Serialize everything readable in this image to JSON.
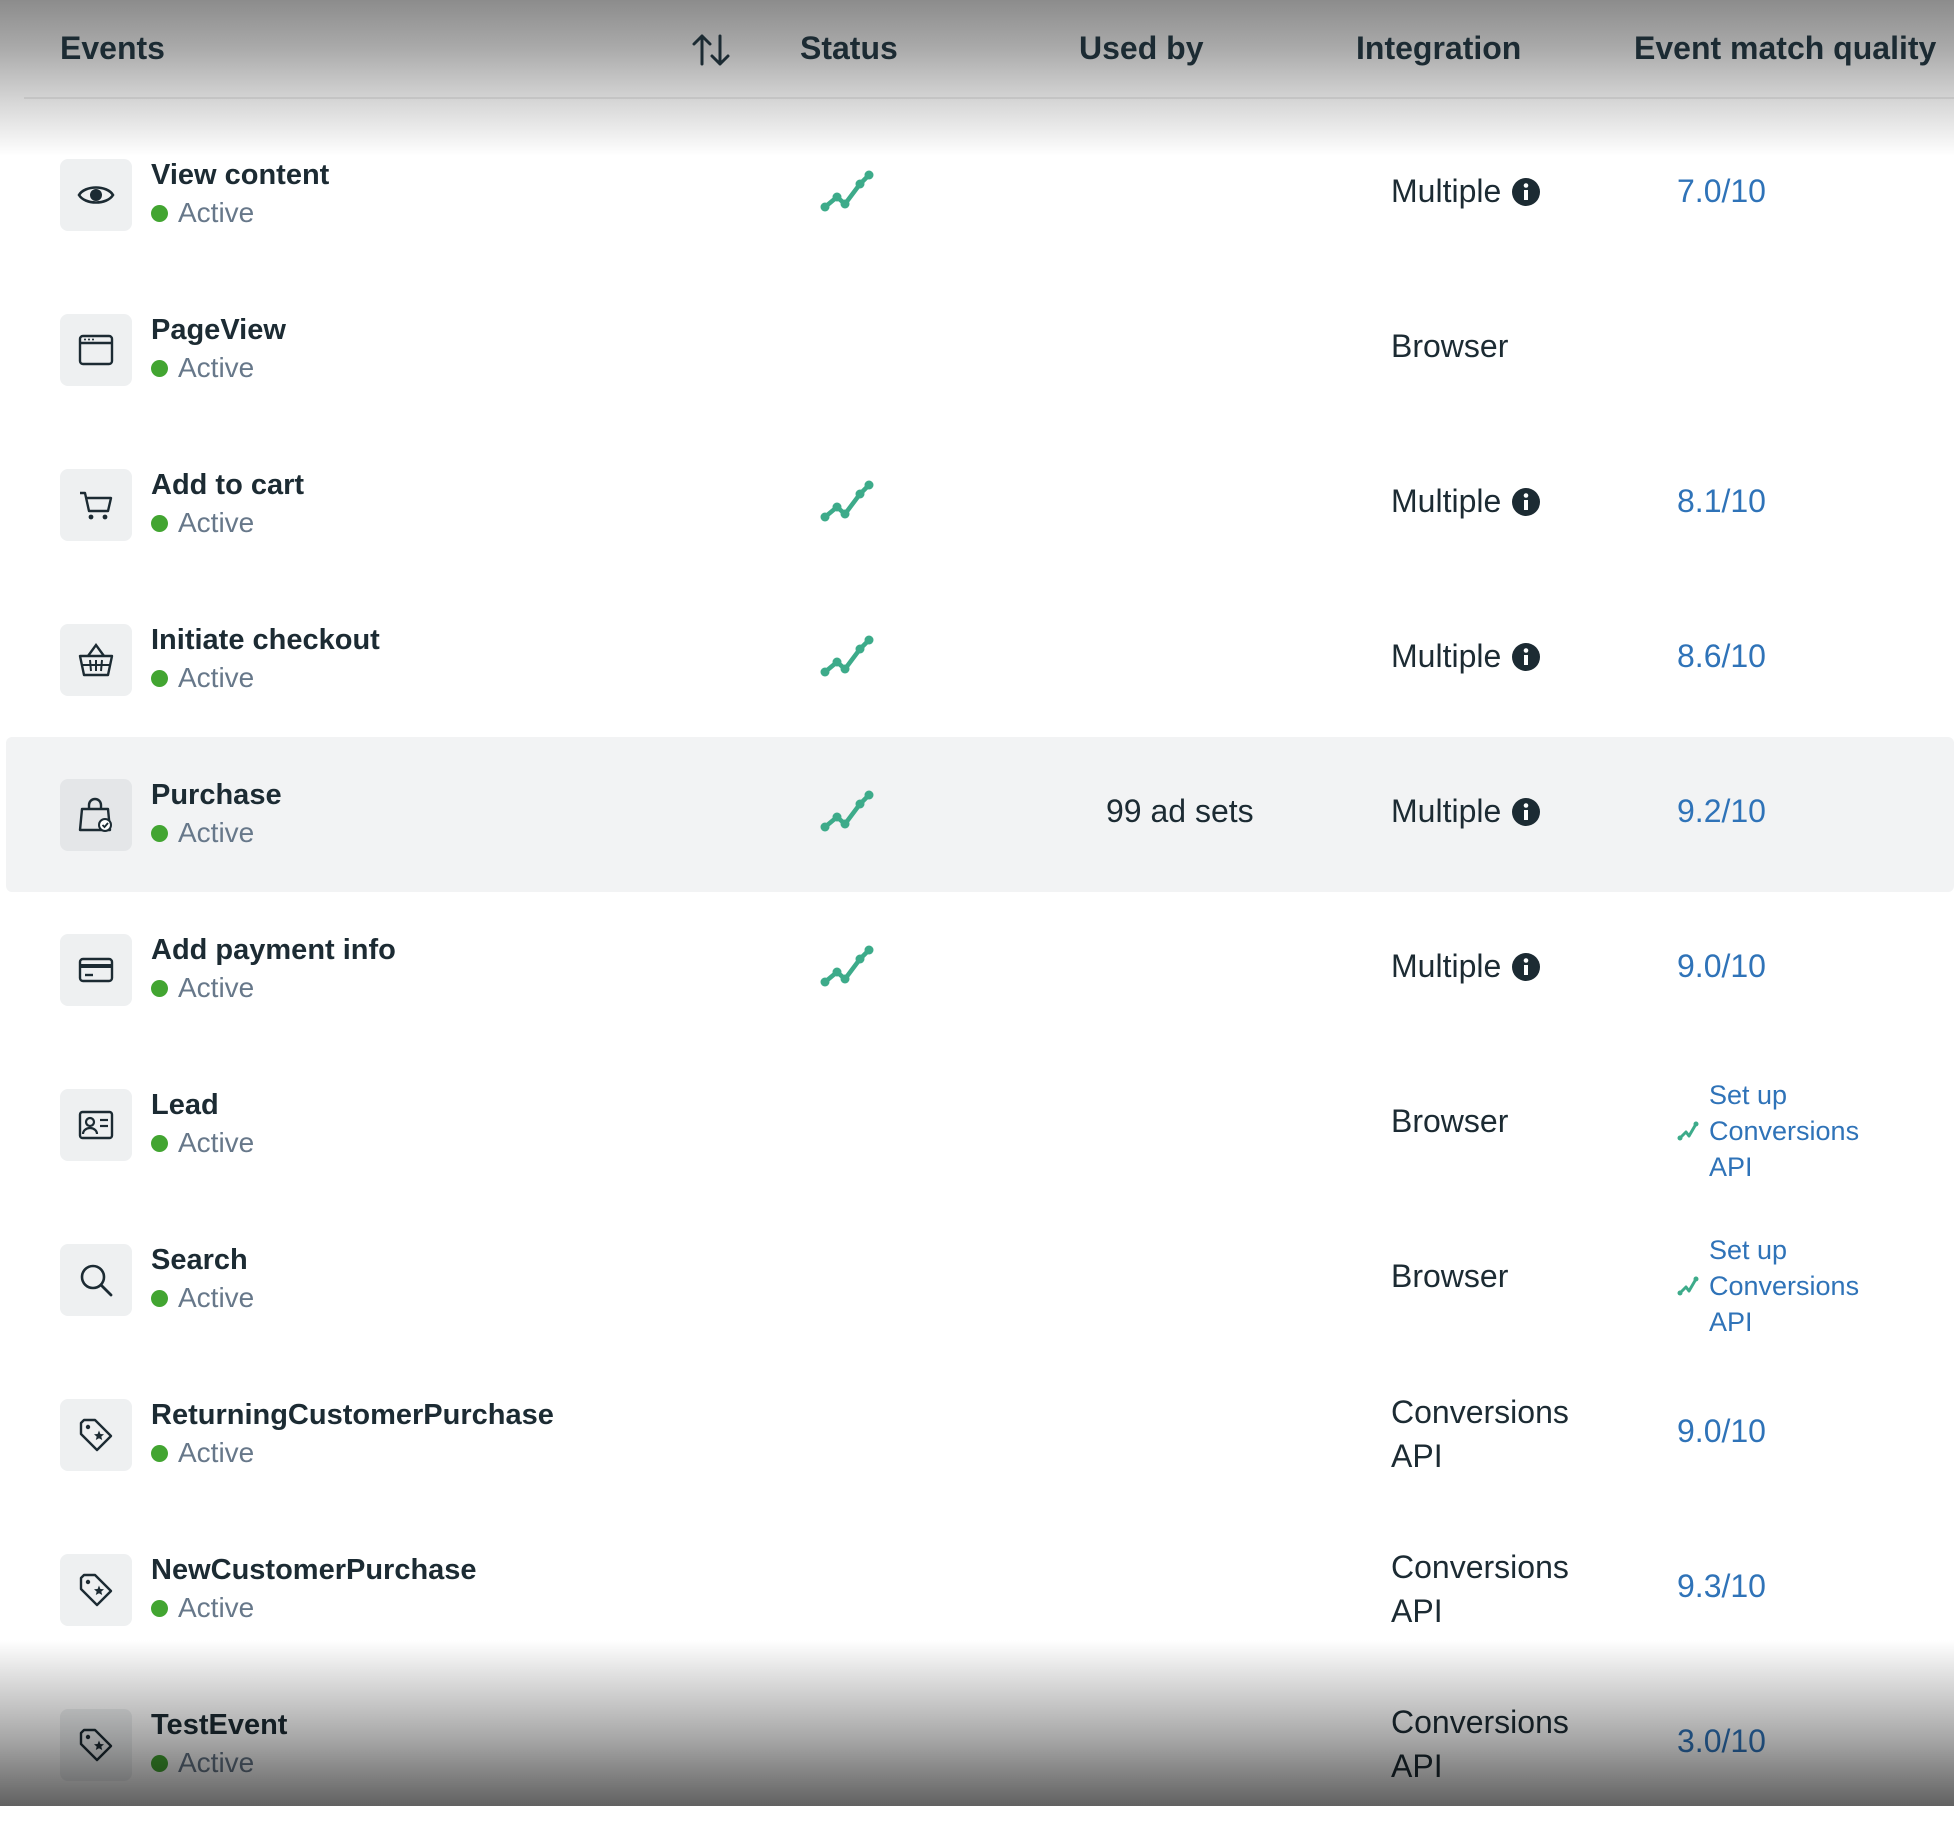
{
  "header": {
    "events_label": "Events",
    "status_label": "Status",
    "used_by_label": "Used by",
    "integration_label": "Integration",
    "emq_label": "Event match quality"
  },
  "colors": {
    "active_dot": "#42a531",
    "link": "#2f73b8",
    "activity_line": "#3dab8a"
  },
  "events": [
    {
      "name": "View content",
      "status": "Active",
      "icon": "eye-icon",
      "has_activity": true,
      "used_by": "",
      "integration_line1": "Multiple",
      "integration_line2": "",
      "integration_info": true,
      "emq": "7.0/10"
    },
    {
      "name": "PageView",
      "status": "Active",
      "icon": "browser-window-icon",
      "has_activity": false,
      "used_by": "",
      "integration_line1": "Browser",
      "integration_line2": "",
      "integration_info": false,
      "emq": ""
    },
    {
      "name": "Add to cart",
      "status": "Active",
      "icon": "shopping-cart-icon",
      "has_activity": true,
      "used_by": "",
      "integration_line1": "Multiple",
      "integration_line2": "",
      "integration_info": true,
      "emq": "8.1/10"
    },
    {
      "name": "Initiate checkout",
      "status": "Active",
      "icon": "basket-icon",
      "has_activity": true,
      "used_by": "",
      "integration_line1": "Multiple",
      "integration_line2": "",
      "integration_info": true,
      "emq": "8.6/10"
    },
    {
      "name": "Purchase",
      "status": "Active",
      "icon": "shopping-bag-icon",
      "has_activity": true,
      "used_by": "99 ad sets",
      "integration_line1": "Multiple",
      "integration_line2": "",
      "integration_info": true,
      "emq": "9.2/10",
      "highlighted": true
    },
    {
      "name": "Add payment info",
      "status": "Active",
      "icon": "credit-card-icon",
      "has_activity": true,
      "used_by": "",
      "integration_line1": "Multiple",
      "integration_line2": "",
      "integration_info": true,
      "emq": "9.0/10"
    },
    {
      "name": "Lead",
      "status": "Active",
      "icon": "contact-card-icon",
      "has_activity": false,
      "used_by": "",
      "integration_line1": "Browser",
      "integration_line2": "",
      "integration_info": false,
      "emq": "",
      "setup_link": "Set up Conversions API"
    },
    {
      "name": "Search",
      "status": "Active",
      "icon": "search-icon",
      "has_activity": false,
      "used_by": "",
      "integration_line1": "Browser",
      "integration_line2": "",
      "integration_info": false,
      "emq": "",
      "setup_link": "Set up Conversions API"
    },
    {
      "name": "ReturningCustomerPurchase",
      "status": "Active",
      "icon": "tag-icon",
      "has_activity": false,
      "used_by": "",
      "integration_line1": "Conversions",
      "integration_line2": "API",
      "integration_info": false,
      "emq": "9.0/10"
    },
    {
      "name": "NewCustomerPurchase",
      "status": "Active",
      "icon": "tag-icon",
      "has_activity": false,
      "used_by": "",
      "integration_line1": "Conversions",
      "integration_line2": "API",
      "integration_info": false,
      "emq": "9.3/10"
    },
    {
      "name": "TestEvent",
      "status": "Active",
      "icon": "tag-icon",
      "has_activity": false,
      "used_by": "",
      "integration_line1": "Conversions",
      "integration_line2": "API",
      "integration_info": false,
      "emq": "3.0/10"
    }
  ]
}
